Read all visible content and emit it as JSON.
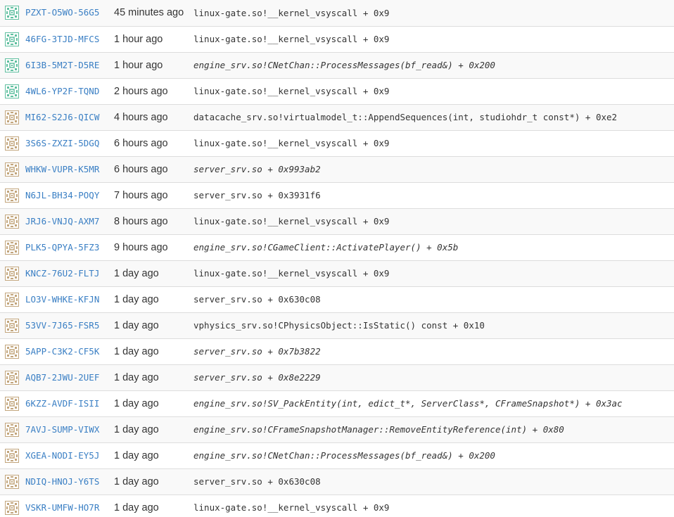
{
  "crash_reports": [
    {
      "id": "PZXT-O5WO-56G5",
      "time": "45 minutes ago",
      "signature": "linux-gate.so!__kernel_vsyscall + 0x9",
      "italic": false,
      "icon": "green-pattern-avatar-icon",
      "icon_color": "#5fbf9f"
    },
    {
      "id": "46FG-3TJD-MFCS",
      "time": "1 hour ago",
      "signature": "linux-gate.so!__kernel_vsyscall + 0x9",
      "italic": false,
      "icon": "green-pattern-avatar-icon",
      "icon_color": "#5fbf9f"
    },
    {
      "id": "6I3B-5M2T-D5RE",
      "time": "1 hour ago",
      "signature": "engine_srv.so!CNetChan::ProcessMessages(bf_read&) + 0x200",
      "italic": true,
      "icon": "green-pattern-avatar-icon",
      "icon_color": "#5fbf9f"
    },
    {
      "id": "4WL6-YP2F-TQND",
      "time": "2 hours ago",
      "signature": "linux-gate.so!__kernel_vsyscall + 0x9",
      "italic": false,
      "icon": "green-pattern-avatar-icon",
      "icon_color": "#5fbf9f"
    },
    {
      "id": "MI62-S2J6-QICW",
      "time": "4 hours ago",
      "signature": "datacache_srv.so!virtualmodel_t::AppendSequences(int, studiohdr_t const*) + 0xe2",
      "italic": false,
      "icon": "tan-pattern-avatar-icon",
      "icon_color": "#c2a57c"
    },
    {
      "id": "3S6S-ZXZI-5DGQ",
      "time": "6 hours ago",
      "signature": "linux-gate.so!__kernel_vsyscall + 0x9",
      "italic": false,
      "icon": "tan-pattern-avatar-icon",
      "icon_color": "#c2a57c"
    },
    {
      "id": "WHKW-VUPR-K5MR",
      "time": "6 hours ago",
      "signature": "server_srv.so + 0x993ab2",
      "italic": true,
      "icon": "tan-pattern-avatar-icon",
      "icon_color": "#c2a57c"
    },
    {
      "id": "N6JL-BH34-POQY",
      "time": "7 hours ago",
      "signature": "server_srv.so + 0x3931f6",
      "italic": false,
      "icon": "tan-pattern-avatar-icon",
      "icon_color": "#c2a57c"
    },
    {
      "id": "JRJ6-VNJQ-AXM7",
      "time": "8 hours ago",
      "signature": "linux-gate.so!__kernel_vsyscall + 0x9",
      "italic": false,
      "icon": "tan-pattern-avatar-icon",
      "icon_color": "#c2a57c"
    },
    {
      "id": "PLK5-QPYA-5FZ3",
      "time": "9 hours ago",
      "signature": "engine_srv.so!CGameClient::ActivatePlayer() + 0x5b",
      "italic": true,
      "icon": "tan-pattern-avatar-icon",
      "icon_color": "#c2a57c"
    },
    {
      "id": "KNCZ-76U2-FLTJ",
      "time": "1 day ago",
      "signature": "linux-gate.so!__kernel_vsyscall + 0x9",
      "italic": false,
      "icon": "tan-pattern-avatar-icon",
      "icon_color": "#c2a57c"
    },
    {
      "id": "LO3V-WHKE-KFJN",
      "time": "1 day ago",
      "signature": "server_srv.so + 0x630c08",
      "italic": false,
      "icon": "tan-pattern-avatar-icon",
      "icon_color": "#c2a57c"
    },
    {
      "id": "53VV-7J65-FSR5",
      "time": "1 day ago",
      "signature": "vphysics_srv.so!CPhysicsObject::IsStatic() const + 0x10",
      "italic": false,
      "icon": "tan-pattern-avatar-icon",
      "icon_color": "#c2a57c"
    },
    {
      "id": "5APP-C3K2-CF5K",
      "time": "1 day ago",
      "signature": "server_srv.so + 0x7b3822",
      "italic": true,
      "icon": "tan-pattern-avatar-icon",
      "icon_color": "#c2a57c"
    },
    {
      "id": "AQB7-2JWU-2UEF",
      "time": "1 day ago",
      "signature": "server_srv.so + 0x8e2229",
      "italic": true,
      "icon": "tan-pattern-avatar-icon",
      "icon_color": "#c2a57c"
    },
    {
      "id": "6KZZ-AVDF-ISII",
      "time": "1 day ago",
      "signature": "engine_srv.so!SV_PackEntity(int, edict_t*, ServerClass*, CFrameSnapshot*) + 0x3ac",
      "italic": true,
      "icon": "tan-pattern-avatar-icon",
      "icon_color": "#c2a57c"
    },
    {
      "id": "7AVJ-SUMP-VIWX",
      "time": "1 day ago",
      "signature": "engine_srv.so!CFrameSnapshotManager::RemoveEntityReference(int) + 0x80",
      "italic": true,
      "icon": "tan-pattern-avatar-icon",
      "icon_color": "#c2a57c"
    },
    {
      "id": "XGEA-NODI-EY5J",
      "time": "1 day ago",
      "signature": "engine_srv.so!CNetChan::ProcessMessages(bf_read&) + 0x200",
      "italic": true,
      "icon": "tan-pattern-avatar-icon",
      "icon_color": "#c2a57c"
    },
    {
      "id": "NDIQ-HNOJ-Y6TS",
      "time": "1 day ago",
      "signature": "server_srv.so + 0x630c08",
      "italic": false,
      "icon": "tan-pattern-avatar-icon",
      "icon_color": "#c2a57c"
    },
    {
      "id": "VSKR-UMFW-HO7R",
      "time": "1 day ago",
      "signature": "linux-gate.so!__kernel_vsyscall + 0x9",
      "italic": false,
      "icon": "tan-pattern-avatar-icon",
      "icon_color": "#c2a57c"
    }
  ],
  "colors": {
    "link": "#3a7fc4",
    "text": "#333333",
    "row_alt": "#f9f9f9",
    "border": "#dddddd"
  }
}
